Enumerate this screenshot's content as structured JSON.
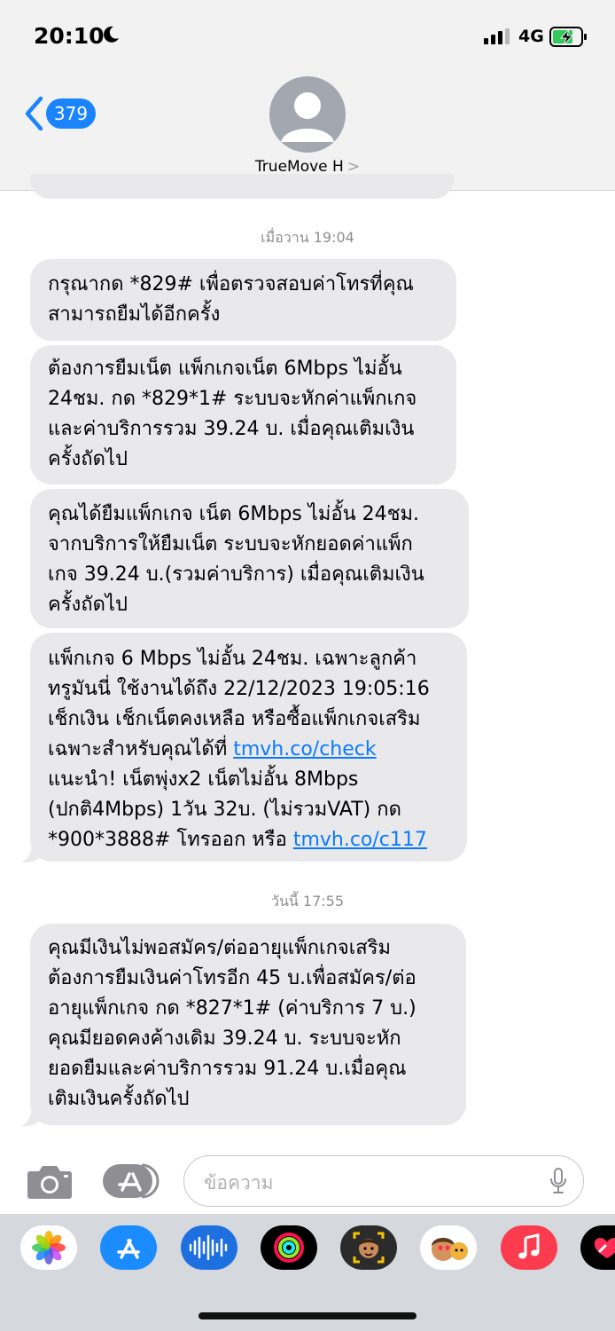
{
  "status": {
    "time": "20:10",
    "network": "4G"
  },
  "nav": {
    "unread_count": "379",
    "contact_name": "TrueMove H",
    "contact_chevron": ">"
  },
  "stamps": [
    "เมื่อวาน 19:04",
    "วันนี้ 17:55"
  ],
  "messages": [
    {
      "lines": [
        "กรุณากด *829# เพื่อตรวจสอบค่าโทรที่คุณ",
        "สามารถยืมได้อีกครั้ง"
      ]
    },
    {
      "lines": [
        "ต้องการยืมเน็ต แพ็กเกจเน็ต 6Mbps ไม่อั้น",
        "24ชม. กด *829*1# ระบบจะหักค่าแพ็กเกจ",
        "และค่าบริการรวม 39.24 บ. เมื่อคุณเติมเงิน",
        "ครั้งถัดไป"
      ]
    },
    {
      "lines": [
        "คุณได้ยืมแพ็กเกจ เน็ต 6Mbps ไม่อั้น 24ชม.",
        "จากบริการให้ยืมเน็ต ระบบจะหักยอดค่าแพ็ก",
        "เกจ 39.24 บ.(รวมค่าบริการ) เมื่อคุณเติมเงิน",
        "ครั้งถัดไป"
      ]
    },
    {
      "line1": "แพ็กเกจ 6 Mbps ไม่อั้น 24ชม. เฉพาะลูกค้า",
      "line2": "ทรูมันนี่ ใช้งานได้ถึง 22/12/2023 19:05:16",
      "line3": "เช็กเงิน เช็กเน็ตคงเหลือ หรือซื้อแพ็กเกจเสริม",
      "line4_text": "เฉพาะสำหรับคุณได้ที่ ",
      "line4_link": "tmvh.co/check",
      "line5": "แนะนำ! เน็ตพุ่งx2 เน็ตไม่อั้น 8Mbps",
      "line6": "(ปกติ4Mbps) 1วัน 32บ. (ไม่รวมVAT) กด",
      "line7_text": "*900*3888# โทรออก หรือ ",
      "line7_link": "tmvh.co/c117"
    },
    {
      "lines": [
        "คุณมีเงินไม่พอสมัคร/ต่ออายุแพ็กเกจเสริม",
        "ต้องการยืมเงินค่าโทรอีก 45 บ.เพื่อสมัคร/ต่อ",
        "อายุแพ็กเกจ กด *827*1# (ค่าบริการ 7 บ.)",
        "คุณมียอดคงค้างเดิม 39.24 บ. ระบบจะหัก",
        "ยอดยืมและค่าบริการรวม 91.24 บ.เมื่อคุณ",
        "เติมเงินครั้งถัดไป"
      ]
    }
  ],
  "composer": {
    "placeholder": "ข้อความ"
  },
  "colors": {
    "bubble": "#e9e9eb",
    "accent": "#1a84ff",
    "link": "#0a7aff"
  },
  "icons": [
    "moon-icon",
    "signal-icon",
    "battery-charging-icon",
    "back-chevron-icon",
    "person-icon",
    "camera-icon",
    "app-store-icon",
    "mic-icon",
    "photos-app-icon",
    "app-store-app-icon",
    "audio-app-icon",
    "fitness-app-icon",
    "memoji-app-icon",
    "animoji-app-icon",
    "music-app-icon",
    "heart-app-icon"
  ]
}
